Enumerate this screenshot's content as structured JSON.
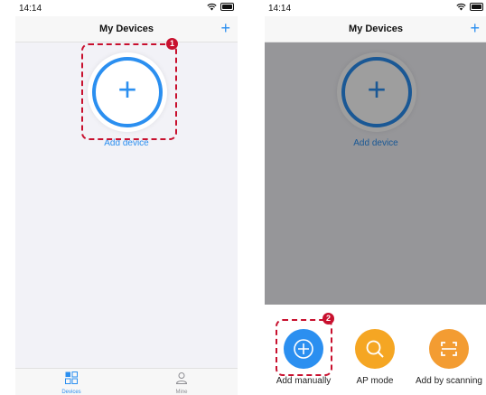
{
  "colors": {
    "accent": "#2b8ff0",
    "ap_mode": "#f5a623",
    "scan": "#f39c32",
    "highlight": "#c8102e"
  },
  "left_screen": {
    "status": {
      "time": "14:14",
      "icons": [
        "wifi-icon",
        "battery-icon"
      ]
    },
    "nav": {
      "title": "My Devices",
      "add_symbol": "+"
    },
    "add_device": {
      "symbol": "+",
      "label": "Add device"
    },
    "badge": "1",
    "tabs": [
      {
        "label": "Devices",
        "icon": "devices-grid-icon",
        "active": true
      },
      {
        "label": "Mine",
        "icon": "person-icon",
        "active": false
      }
    ]
  },
  "right_screen": {
    "status": {
      "time": "14:14",
      "icons": [
        "wifi-icon",
        "battery-icon"
      ]
    },
    "nav": {
      "title": "My Devices",
      "add_symbol": "+"
    },
    "add_device": {
      "symbol": "+",
      "label": "Add device"
    },
    "badge": "2",
    "sheet_buttons": [
      {
        "label": "Add manually",
        "icon": "plus-circle-icon"
      },
      {
        "label": "AP mode",
        "icon": "search-icon"
      },
      {
        "label": "Add by scanning",
        "icon": "scan-icon"
      }
    ]
  }
}
